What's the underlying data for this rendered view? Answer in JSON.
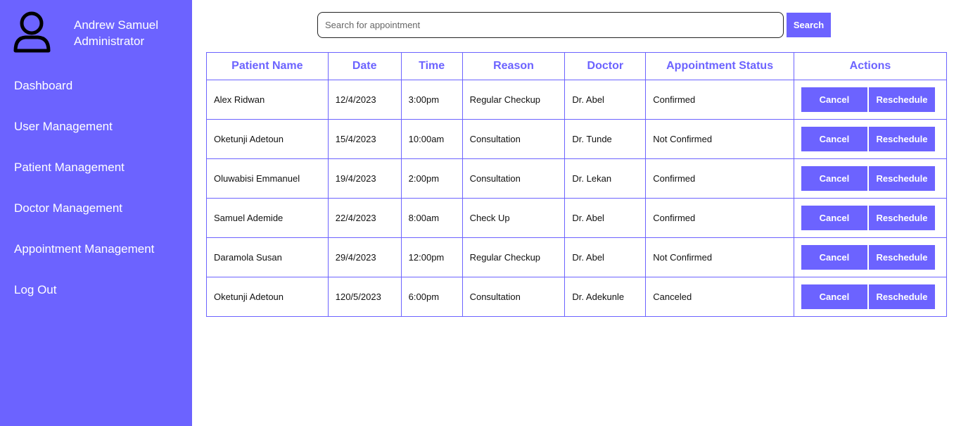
{
  "user": {
    "name": "Andrew Samuel",
    "role": "Administrator",
    "avatar_icon": "user-icon"
  },
  "nav": [
    {
      "label": "Dashboard"
    },
    {
      "label": "User Management"
    },
    {
      "label": "Patient Management"
    },
    {
      "label": "Doctor Management"
    },
    {
      "label": "Appointment Management"
    },
    {
      "label": "Log Out"
    }
  ],
  "search": {
    "placeholder": "Search for appointment",
    "value": "",
    "button_label": "Search"
  },
  "table": {
    "headers": [
      "Patient Name",
      "Date",
      "Time",
      "Reason",
      "Doctor",
      "Appointment Status",
      "Actions"
    ],
    "rows": [
      [
        "Alex Ridwan",
        "12/4/2023",
        "3:00pm",
        "Regular Checkup",
        "Dr. Abel",
        "Confirmed"
      ],
      [
        "Oketunji Adetoun",
        "15/4/2023",
        "10:00am",
        "Consultation",
        "Dr. Tunde",
        "Not Confirmed"
      ],
      [
        "Oluwabisi Emmanuel",
        "19/4/2023",
        "2:00pm",
        "Consultation",
        "Dr. Lekan",
        "Confirmed"
      ],
      [
        "Samuel Ademide",
        "22/4/2023",
        "8:00am",
        "Check Up",
        "Dr. Abel",
        "Confirmed"
      ],
      [
        "Daramola Susan",
        "29/4/2023",
        "12:00pm",
        "Regular Checkup",
        "Dr. Abel",
        "Not Confirmed"
      ],
      [
        "Oketunji Adetoun",
        "120/5/2023",
        "6:00pm",
        "Consultation",
        "Dr. Adekunle",
        "Canceled"
      ]
    ],
    "cancel_label": "Cancel",
    "reschedule_label": "Reschedule"
  },
  "colors": {
    "accent": "#6c63ff",
    "background": "#ffffff"
  }
}
